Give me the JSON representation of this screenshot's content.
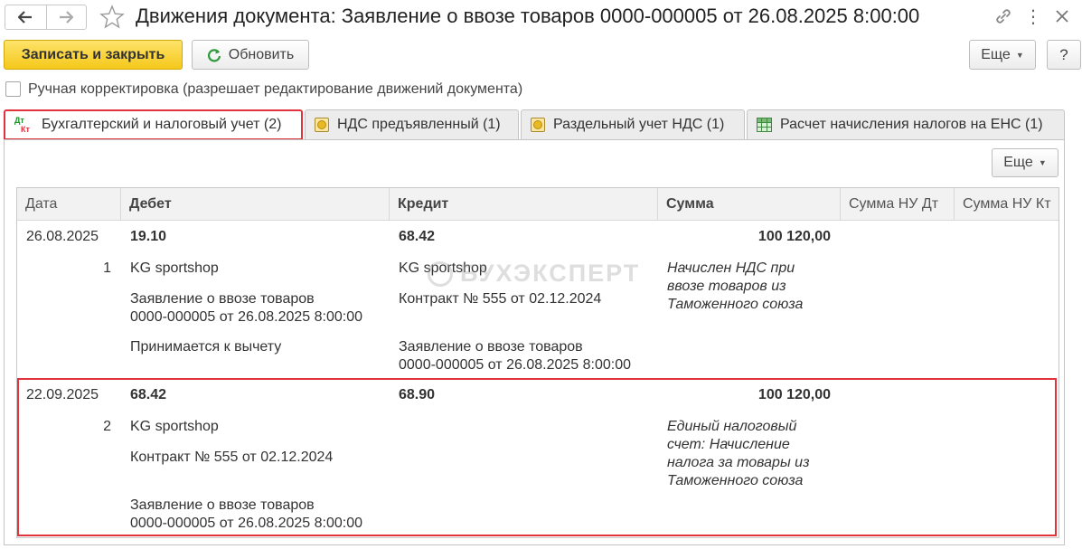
{
  "window": {
    "title": "Движения документа: Заявление о ввозе товаров 0000-000005 от 26.08.2025 8:00:00",
    "back_icon": "arrow-left-icon",
    "forward_icon": "arrow-right-icon",
    "favorite_icon": "star-icon",
    "link_icon": "link-icon",
    "menu_icon": "more-vertical-icon",
    "close_icon": "close-icon"
  },
  "toolbar": {
    "save_close_label": "Записать и закрыть",
    "refresh_label": "Обновить",
    "more_label": "Еще",
    "help_label": "?"
  },
  "manual_edit": {
    "label": "Ручная корректировка (разрешает редактирование движений документа)",
    "checked": false
  },
  "tabs": [
    {
      "label": "Бухгалтерский и налоговый учет (2)",
      "icon": "dt-kt-icon",
      "active": true
    },
    {
      "label": "НДС предъявленный (1)",
      "icon": "register-icon",
      "active": false
    },
    {
      "label": "Раздельный учет НДС (1)",
      "icon": "register-icon",
      "active": false
    },
    {
      "label": "Расчет начисления налогов на ЕНС (1)",
      "icon": "table-grid-icon",
      "active": false
    }
  ],
  "panel": {
    "more_label": "Еще"
  },
  "table": {
    "columns": [
      "Дата",
      "Дебет",
      "Кредит",
      "Сумма",
      "Сумма НУ Дт",
      "Сумма НУ Кт"
    ],
    "rows": [
      {
        "date": "26.08.2025",
        "num": "1",
        "debit": "19.10",
        "debit_sub1": "KG sportshop",
        "debit_sub2_l1": "Заявление о ввозе товаров",
        "debit_sub2_l2": "0000-000005 от 26.08.2025 8:00:00",
        "debit_sub3": "Принимается к вычету",
        "credit": "68.42",
        "credit_sub1": "KG sportshop",
        "credit_sub2": "Контракт № 555 от 02.12.2024",
        "credit_sub3_l1": "Заявление о ввозе товаров",
        "credit_sub3_l2": "0000-000005 от 26.08.2025 8:00:00",
        "amount": "100 120,00",
        "content": [
          "Начислен НДС при",
          "ввозе товаров из",
          "Таможенного союза"
        ]
      },
      {
        "date": "22.09.2025",
        "num": "2",
        "debit": "68.42",
        "debit_sub1": "KG sportshop",
        "debit_sub2": "Контракт № 555 от 02.12.2024",
        "debit_sub3_l1": "Заявление о ввозе товаров",
        "debit_sub3_l2": "0000-000005 от 26.08.2025 8:00:00",
        "credit": "68.90",
        "amount": "100 120,00",
        "content": [
          "Единый налоговый",
          "счет: Начисление",
          "налога за товары из",
          "Таможенного союза"
        ]
      }
    ]
  },
  "watermark": "БУХЭКСПЕРТ",
  "colors": {
    "accent": "#f5c81a",
    "highlight": "#e0333c"
  }
}
